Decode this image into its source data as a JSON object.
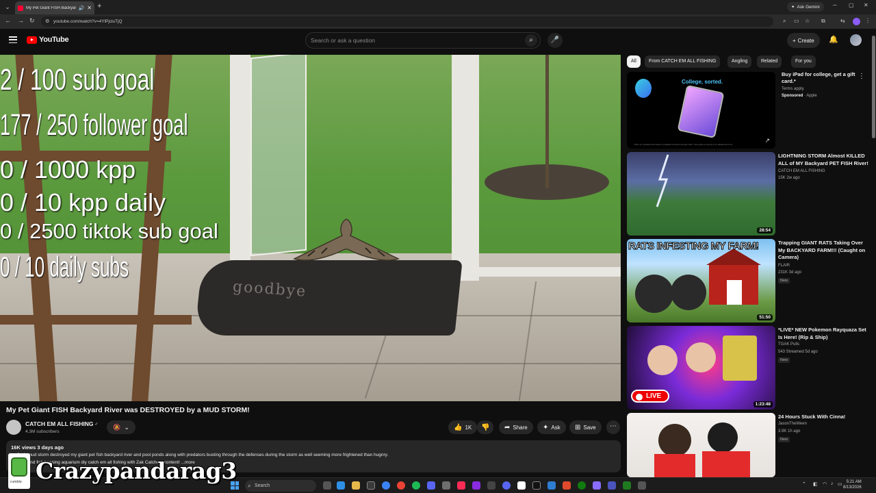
{
  "browser": {
    "tab_title": "My Pet Giant FISH Backyard",
    "url": "youtube.com/watch?v=4YlPjcluTjQ",
    "ask_gemini": "Ask Gemini"
  },
  "header": {
    "logo_text": "YouTube",
    "search_placeholder": "Search or ask a question",
    "create_label": "Create"
  },
  "overlay_goals": [
    "2  / 100 sub goal",
    "177 / 250 follower goal",
    "0 / 1000 kpp",
    "0 / 10 kpp daily",
    "0 / 2500 tiktok sub goal",
    "0 / 10 daily subs"
  ],
  "video": {
    "doormat_text": "goodbye",
    "title": "My Pet Giant FISH Backyard River was DESTROYED by a MUD STORM!",
    "channel": "CATCH EM ALL FISHING",
    "subscribers": "4.3M subscribers",
    "likes": "1K",
    "share_label": "Share",
    "ask_label": "Ask",
    "save_label": "Save",
    "meta": "16K views  3 days ago",
    "description_line1": "t a flash mud storm destroyed my giant pet fish backyard river and pool ponds along with predators busting through the defenses during the storm as well seeming more frightened than hugnry.",
    "description_line2": "r fishing and fish keeping aquarium diy catch em all fishing with Zak Catchem content! ...more"
  },
  "chips": [
    "All",
    "From CATCH EM ALL FISHING",
    "Angling",
    "Related",
    "For you"
  ],
  "ad": {
    "headline": "College, sorted.",
    "title": "Buy iPad for college, get a gift card.*",
    "terms": "Terms apply.",
    "sponsored": "Sponsored",
    "advertiser": "Apple",
    "fine_print": "*Offer for Qualified Purchasers of Eligible Products through 10/27. See apple.com/promo for additional terms."
  },
  "recommendations": [
    {
      "title": "LIGHTNING STORM Almost KILLED ALL of MY Backyard PET FISH River!",
      "channel": "CATCH EM ALL FISHING",
      "stats": "15K  2w ago",
      "duration": "28:54",
      "badge": ""
    },
    {
      "thumb_text": "RATS INFESTING MY FARM!",
      "title": "Trapping GIANT RATS Taking Over My BACKYARD FARM!!! (Caught on Camera)",
      "channel": "FLAIR",
      "stats": "231K  3d ago",
      "duration": "51:50",
      "badge": "New"
    },
    {
      "title": "*LIVE* NEW Pokemon Rayquaza Set Is Here! (Rip & Ship)",
      "channel": "TGAK Pulls",
      "stats": "543  Streamed 5d ago",
      "duration": "1:23:48",
      "badge": "New",
      "live_label": "LIVE"
    },
    {
      "title": "24 Hours Stuck With Cinna!",
      "channel": "JasonTheWeen",
      "stats": "3.9K  1h ago",
      "duration": "",
      "badge": "New"
    }
  ],
  "taskbar": {
    "search_label": "Search",
    "time": "5:21 AM",
    "date": "8/13/2026"
  },
  "watermark": {
    "label": "rumble",
    "name": "Crazypandarag3"
  },
  "colors": {
    "background": "#0f0f0f",
    "brand_red": "#ff0000",
    "chip_bg": "#272727"
  }
}
